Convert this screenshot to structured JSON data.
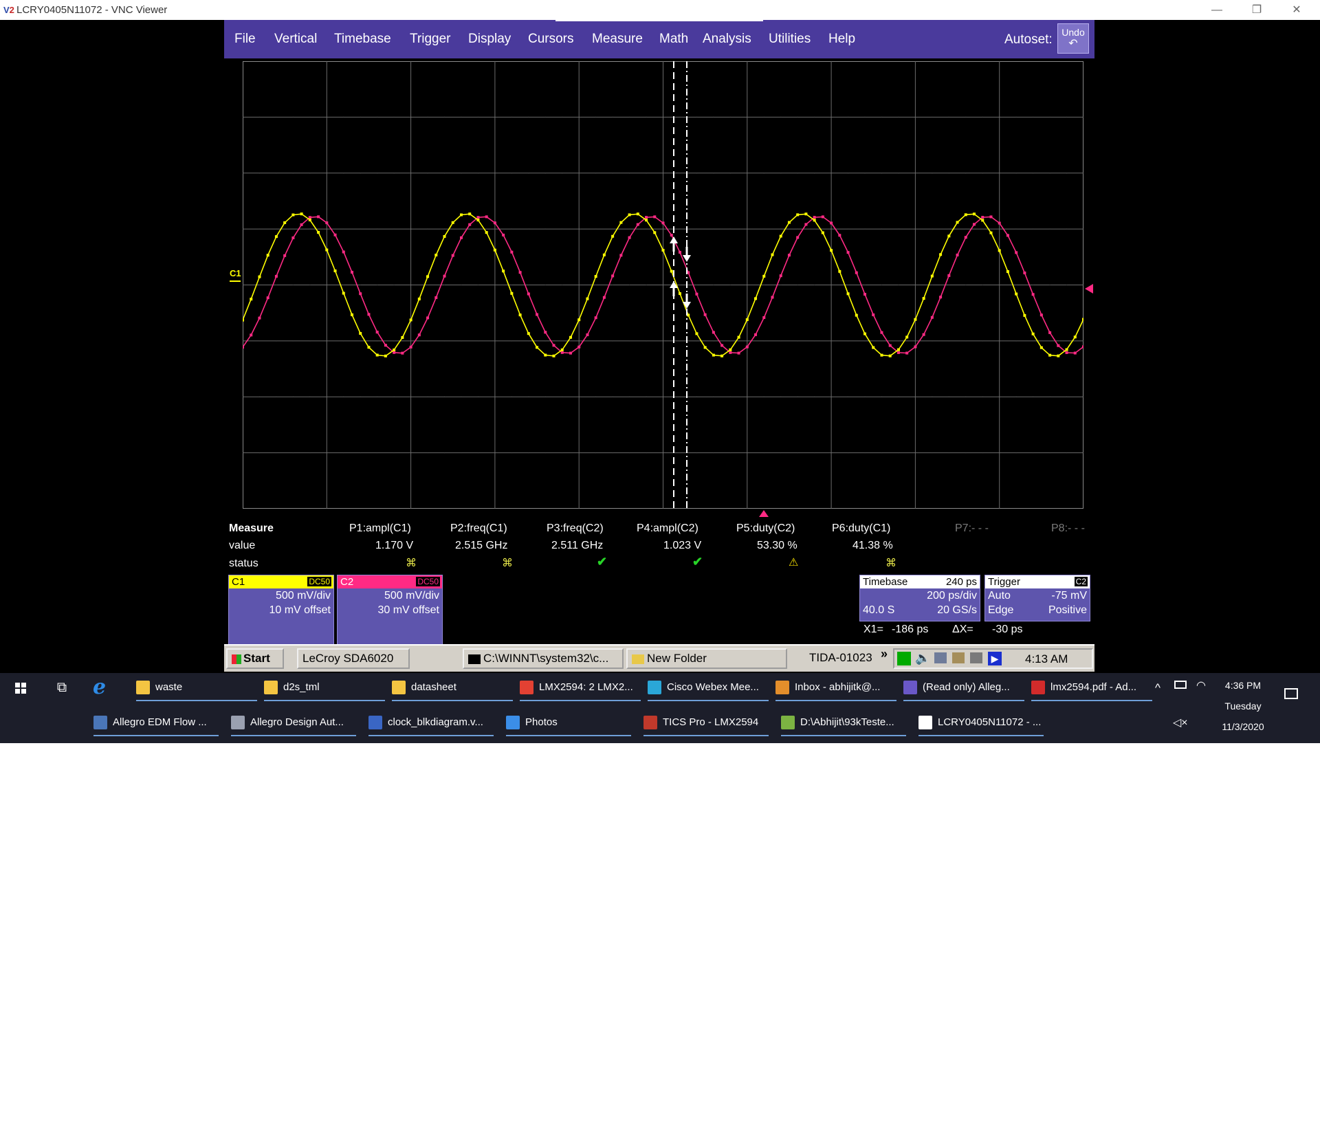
{
  "window": {
    "title": "LCRY0405N11072 - VNC Viewer",
    "controls": {
      "minimize": "—",
      "restore": "❐",
      "close": "✕"
    }
  },
  "menu": {
    "items": [
      "File",
      "Vertical",
      "Timebase",
      "Trigger",
      "Display",
      "Cursors",
      "Measure",
      "Math",
      "Analysis",
      "Utilities",
      "Help"
    ],
    "autoset_label": "Autoset:",
    "undo_label": "Undo",
    "undo_icon": "↶"
  },
  "grid": {
    "channel_marker": "C1",
    "trigger_marker_color": "#ff2a84",
    "colors": {
      "c1": "#ffff00",
      "c2": "#ff2a84",
      "grid": "#6c6c6c"
    }
  },
  "measure": {
    "header": "Measure",
    "value_label": "value",
    "status_label": "status",
    "params": [
      {
        "name": "P1:ampl(C1)",
        "value": "1.170 V",
        "status": "x"
      },
      {
        "name": "P2:freq(C1)",
        "value": "2.515 GHz",
        "status": "x"
      },
      {
        "name": "P3:freq(C2)",
        "value": "2.511 GHz",
        "status": "ok"
      },
      {
        "name": "P4:ampl(C2)",
        "value": "1.023 V",
        "status": "ok"
      },
      {
        "name": "P5:duty(C2)",
        "value": "53.30 %",
        "status": "warn"
      },
      {
        "name": "P6:duty(C1)",
        "value": "41.38 %",
        "status": "x"
      },
      {
        "name": "P7:- - -",
        "value": "",
        "status": ""
      },
      {
        "name": "P8:- - -",
        "value": "",
        "status": ""
      }
    ]
  },
  "channels": {
    "c1": {
      "name": "C1",
      "coupling": "DC50",
      "vdiv": "500 mV/div",
      "offset": "10 mV offset",
      "color": "#ffff00"
    },
    "c2": {
      "name": "C2",
      "coupling": "DC50",
      "vdiv": "500 mV/div",
      "offset": "30 mV offset",
      "color": "#ff2a84"
    }
  },
  "timebase": {
    "label": "Timebase",
    "delay": "240 ps",
    "tdiv": "200 ps/div",
    "memory": "40.0 S",
    "rate": "20 GS/s"
  },
  "trigger": {
    "label": "Trigger",
    "source": "C2",
    "mode": "Auto",
    "level": "-75 mV",
    "type": "Edge",
    "slope": "Positive"
  },
  "cursors": {
    "x1_label": "X1=",
    "x1": "-186 ps",
    "dx_label": "ΔX=",
    "dx": "-30 ps"
  },
  "inner_taskbar": {
    "start": "Start",
    "buttons": [
      "LeCroy SDA6020",
      "C:\\WINNT\\system32\\c...",
      "New Folder"
    ],
    "tida": "TIDA-01023",
    "chevron": "»",
    "time": "4:13 AM"
  },
  "taskbar": {
    "row1": [
      {
        "label": "waste",
        "icon": "folder-icon",
        "color": "#f4c542"
      },
      {
        "label": "d2s_tml",
        "icon": "folder-icon",
        "color": "#f4c542"
      },
      {
        "label": "datasheet",
        "icon": "folder-icon",
        "color": "#f4c542"
      },
      {
        "label": "LMX2594: 2 LMX2...",
        "icon": "chrome-icon",
        "color": "#e34133"
      },
      {
        "label": "Cisco Webex Mee...",
        "icon": "webex-icon",
        "color": "#2aa7d8"
      },
      {
        "label": "Inbox - abhijitk@...",
        "icon": "outlook-icon",
        "color": "#e38e2b"
      },
      {
        "label": "(Read only) Alleg...",
        "icon": "allegro-icon",
        "color": "#6a58c8"
      },
      {
        "label": "lmx2594.pdf - Ad...",
        "icon": "pdf-icon",
        "color": "#d22b2b"
      }
    ],
    "row2": [
      {
        "label": "Allegro EDM Flow ...",
        "icon": "gear-icon",
        "color": "#4a76b8"
      },
      {
        "label": "Allegro Design Aut...",
        "icon": "allegro-design-icon",
        "color": "#9aa0b0"
      },
      {
        "label": "clock_blkdiagram.v...",
        "icon": "visio-icon",
        "color": "#3a66c4"
      },
      {
        "label": "Photos",
        "icon": "photos-icon",
        "color": "#3b8ee8"
      },
      {
        "label": "TICS Pro - LMX2594",
        "icon": "tics-icon",
        "color": "#c0392b"
      },
      {
        "label": "D:\\Abhijit\\93kTeste...",
        "icon": "editor-icon",
        "color": "#7cb342"
      },
      {
        "label": "LCRY0405N11072 - ...",
        "icon": "vnc-icon",
        "color": "#ffffff"
      }
    ],
    "clock": {
      "time": "4:36 PM",
      "day": "Tuesday",
      "date": "11/3/2020"
    }
  }
}
